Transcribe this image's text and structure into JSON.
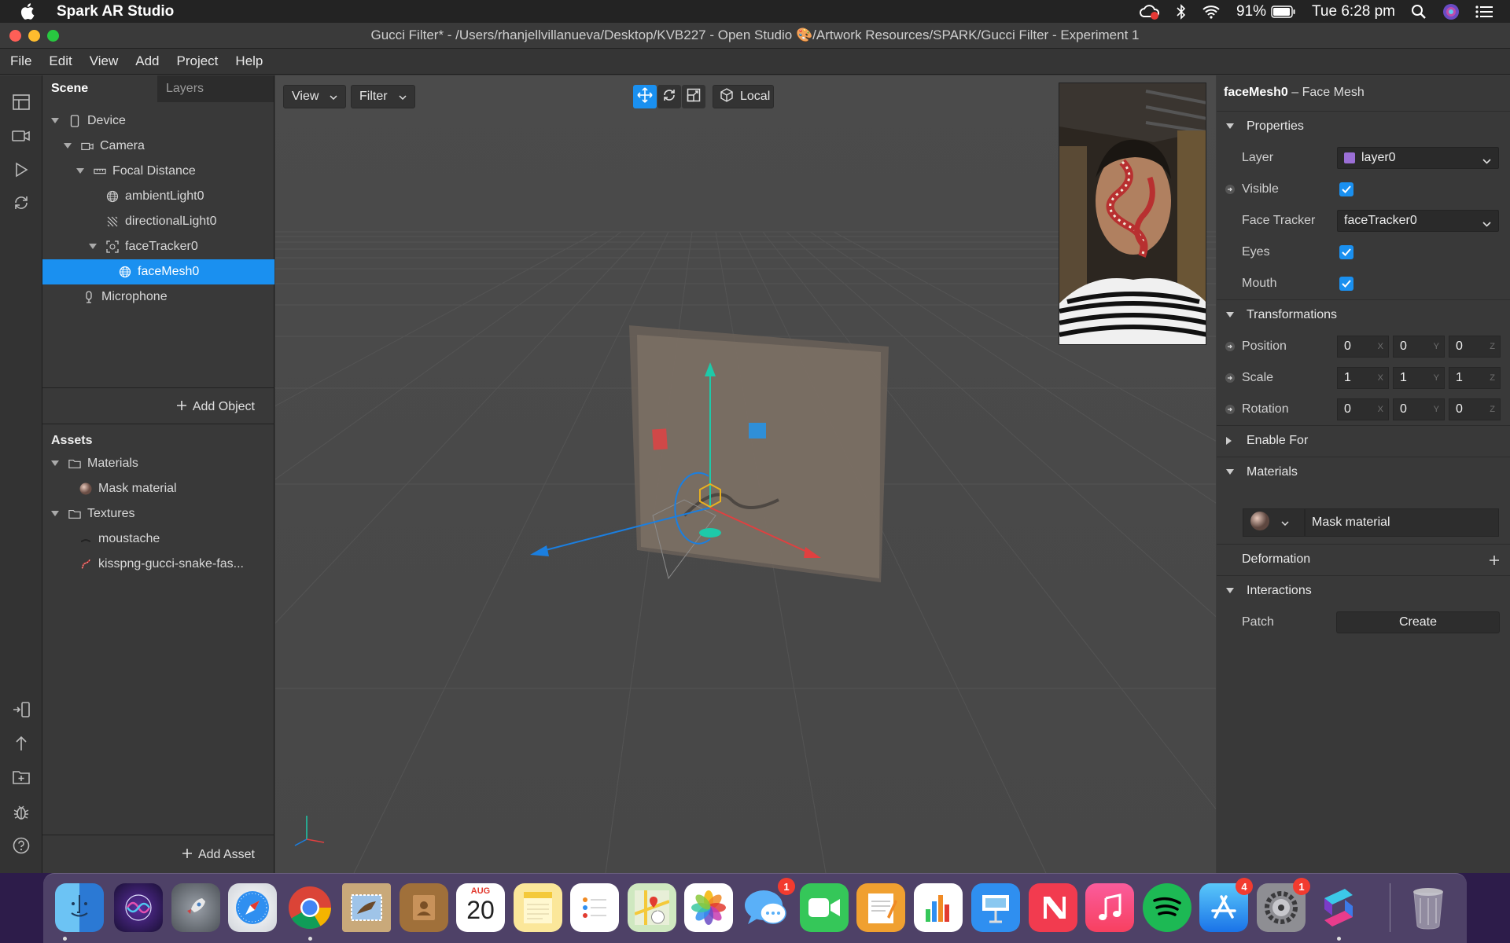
{
  "menubar": {
    "app_name": "Spark AR Studio",
    "battery": "91%",
    "clock": "Tue 6:28 pm"
  },
  "window": {
    "title": "Gucci Filter* - /Users/rhanjellvillanueva/Desktop/KVB227 - Open Studio 🎨/Artwork Resources/SPARK/Gucci Filter - Experiment 1"
  },
  "app_menu": [
    "File",
    "Edit",
    "View",
    "Add",
    "Project",
    "Help"
  ],
  "scene_panel": {
    "tabs": [
      "Scene",
      "Layers"
    ],
    "tree": [
      {
        "label": "Device",
        "icon": "device-icon"
      },
      {
        "label": "Camera",
        "icon": "camera-icon"
      },
      {
        "label": "Focal Distance",
        "icon": "ruler-icon"
      },
      {
        "label": "ambientLight0",
        "icon": "globe-icon"
      },
      {
        "label": "directionalLight0",
        "icon": "light-icon"
      },
      {
        "label": "faceTracker0",
        "icon": "face-tracker-icon"
      },
      {
        "label": "faceMesh0",
        "icon": "mesh-icon"
      },
      {
        "label": "Microphone",
        "icon": "microphone-icon"
      }
    ],
    "add_object": "Add Object",
    "assets_title": "Assets",
    "assets": [
      {
        "label": "Materials",
        "icon": "folder-icon"
      },
      {
        "label": "Mask material",
        "icon": "material-sphere-icon"
      },
      {
        "label": "Textures",
        "icon": "folder-icon"
      },
      {
        "label": "moustache",
        "icon": "texture-icon"
      },
      {
        "label": "kisspng-gucci-snake-fas...",
        "icon": "texture-icon"
      }
    ],
    "add_asset": "Add Asset"
  },
  "viewport": {
    "view_label": "View",
    "filter_label": "Filter",
    "local_label": "Local"
  },
  "inspector": {
    "object_name": "faceMesh0",
    "object_type": " – Face Mesh",
    "properties_label": "Properties",
    "layer_label": "Layer",
    "layer_value": "layer0",
    "layer_color": "#9b6fd6",
    "visible_label": "Visible",
    "face_tracker_label": "Face Tracker",
    "face_tracker_value": "faceTracker0",
    "eyes_label": "Eyes",
    "mouth_label": "Mouth",
    "transformations_label": "Transformations",
    "position_label": "Position",
    "scale_label": "Scale",
    "rotation_label": "Rotation",
    "position": [
      "0",
      "0",
      "0"
    ],
    "scale": [
      "1",
      "1",
      "1"
    ],
    "rotation": [
      "0",
      "0",
      "0"
    ],
    "axes": [
      "X",
      "Y",
      "Z"
    ],
    "enable_for_label": "Enable For",
    "materials_label": "Materials",
    "material_value": "Mask material",
    "deformation_label": "Deformation",
    "interactions_label": "Interactions",
    "patch_label": "Patch",
    "create_label": "Create"
  },
  "dock": {
    "calendar_month": "AUG",
    "calendar_day": "20",
    "messages_badge": "1",
    "appstore_badge": "4",
    "prefs_badge": "1"
  }
}
